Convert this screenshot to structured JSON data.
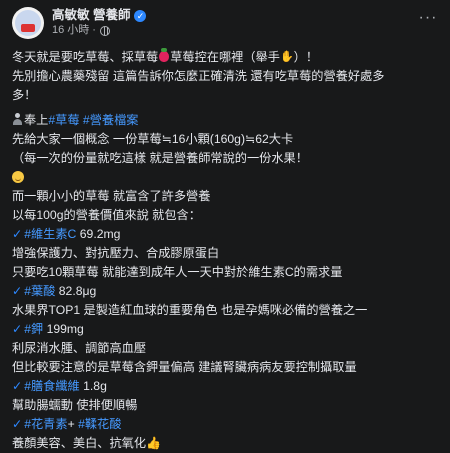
{
  "post": {
    "author": "高敏敏 營養師",
    "time": "16 小時",
    "separator": "·",
    "lines": [
      {
        "segments": [
          {
            "t": "冬天就是要吃草莓、採草莓"
          },
          {
            "icon": "strawberry-icon"
          },
          {
            "t": "草莓控在哪裡（舉手"
          },
          {
            "icon": "hand-icon"
          },
          {
            "t": "）！"
          }
        ]
      },
      {
        "segments": [
          {
            "t": "先別擔心農藥殘留 這篇告訴你怎麼正確清洗 還有吃草莓的營養好處多"
          }
        ]
      },
      {
        "segments": [
          {
            "t": "多！"
          }
        ]
      },
      {
        "gap": true
      },
      {
        "segments": [
          {
            "icon": "person-icon"
          },
          {
            "t": "奉上"
          },
          {
            "tag": "#草莓"
          },
          {
            "t": " "
          },
          {
            "tag": "#營養檔案"
          }
        ]
      },
      {
        "segments": [
          {
            "t": "先給大家一個概念 一份草莓≒16小顆(160g)≒62大卡"
          }
        ]
      },
      {
        "segments": [
          {
            "t": "（每一次的份量就吃這樣 就是營養師常說的一份水果！"
          }
        ]
      },
      {
        "segments": [
          {
            "icon": "smile-icon"
          }
        ]
      },
      {
        "segments": [
          {
            "t": "而一顆小小的草莓 就富含了許多營養"
          }
        ]
      },
      {
        "segments": [
          {
            "t": "以每100g的營養價值來說 就包含："
          }
        ]
      },
      {
        "segments": [
          {
            "icon": "check-icon"
          },
          {
            "tag": "#維生素C"
          },
          {
            "t": " 69.2mg"
          }
        ]
      },
      {
        "segments": [
          {
            "t": "增強保護力、對抗壓力、合成膠原蛋白"
          }
        ]
      },
      {
        "segments": [
          {
            "t": "只要吃10顆草莓 就能達到成年人一天中對於維生素C的需求量"
          }
        ]
      },
      {
        "segments": [
          {
            "icon": "check-icon"
          },
          {
            "tag": "#葉酸"
          },
          {
            "t": " 82.8μg"
          }
        ]
      },
      {
        "segments": [
          {
            "t": "水果界TOP1 是製造紅血球的重要角色 也是孕媽咪必備的營養之一"
          }
        ]
      },
      {
        "segments": [
          {
            "icon": "check-icon"
          },
          {
            "tag": "#鉀"
          },
          {
            "t": " 199mg"
          }
        ]
      },
      {
        "segments": [
          {
            "t": "利尿消水腫、調節高血壓"
          }
        ]
      },
      {
        "segments": [
          {
            "t": "但比較要注意的是草莓含鉀量偏高 建議腎臟病病友要控制攝取量"
          }
        ]
      },
      {
        "segments": [
          {
            "icon": "check-icon"
          },
          {
            "tag": "#膳食纖維"
          },
          {
            "t": " 1.8g"
          }
        ]
      },
      {
        "segments": [
          {
            "t": "幫助腸蠕動 使排便順暢"
          }
        ]
      },
      {
        "segments": [
          {
            "icon": "check-icon"
          },
          {
            "tag": "#花青素"
          },
          {
            "t": "+ "
          },
          {
            "tag": "#鞣花酸"
          }
        ]
      },
      {
        "segments": [
          {
            "t": "養顏美容、美白、抗氧化"
          },
          {
            "icon": "thumb-icon"
          }
        ]
      }
    ]
  },
  "icons": {
    "check-icon": "✓",
    "hand-icon": "✋",
    "thumb-icon": "👍"
  },
  "colors": {
    "background": "#18191a",
    "text": "#e4e6eb",
    "hashtag": "#4599ff",
    "verified": "#2d88ff"
  }
}
